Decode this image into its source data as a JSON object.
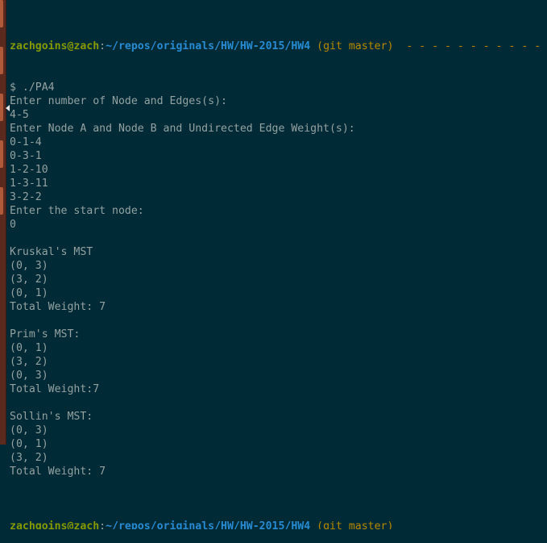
{
  "prompt": {
    "user_host": "zachgoins@zach",
    "separator": ":",
    "path": "~/repos/originals/HW/HW-2015/HW4",
    "git": "(git master)",
    "dashes": "- - - - - - - - - - - -"
  },
  "output_lines": [
    "$ ./PA4",
    "Enter number of Node and Edges(s):",
    "4-5",
    "Enter Node A and Node B and Undirected Edge Weight(s):",
    "0-1-4",
    "0-3-1",
    "1-2-10",
    "1-3-11",
    "3-2-2",
    "Enter the start node:",
    "0",
    "",
    "Kruskal's MST",
    "(0, 3)",
    "(3, 2)",
    "(0, 1)",
    "Total Weight: 7",
    "",
    "Prim's MST:",
    "(0, 1)",
    "(3, 2)",
    "(0, 3)",
    "Total Weight:7",
    "",
    "Sollin's MST:",
    "(0, 3)",
    "(0, 1)",
    "(3, 2)",
    "Total Weight: 7",
    ""
  ]
}
